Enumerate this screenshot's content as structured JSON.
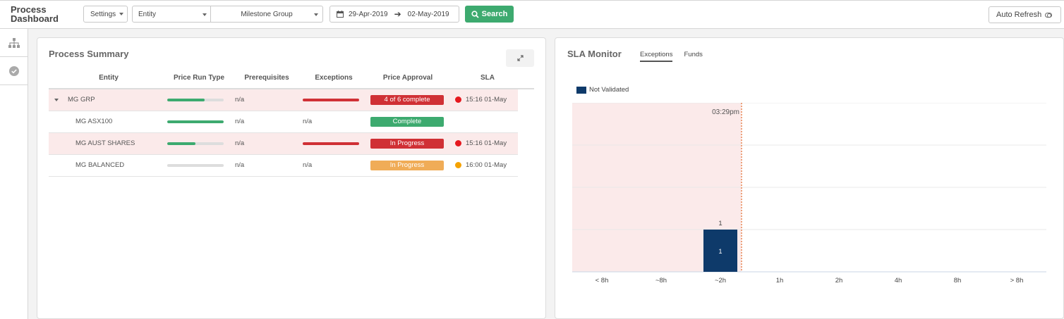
{
  "app": {
    "title_line1": "Process",
    "title_line2": "Dashboard"
  },
  "toolbar": {
    "settings_label": "Settings",
    "entity_value": "Entity",
    "milestone_value": "Milestone Group",
    "date_from": "29-Apr-2019",
    "date_to": "02-May-2019",
    "search_label": "Search",
    "auto_refresh_label": "Auto Refresh"
  },
  "sidebar": {
    "items": [
      {
        "icon": "hierarchy-icon"
      },
      {
        "icon": "check-circle-icon"
      }
    ]
  },
  "process_summary": {
    "title": "Process Summary",
    "columns": [
      "Entity",
      "Price Run Type",
      "Prerequisites",
      "Exceptions",
      "Price Approval",
      "SLA"
    ],
    "rows": [
      {
        "entity": "MG GRP",
        "expandable": true,
        "price_run_progress": 0.66,
        "prerequisites": "n/a",
        "exceptions": "",
        "has_exception_bar": true,
        "approval": "4 of 6 complete",
        "approval_color": "#d03035",
        "sla_dot": "#e5181e",
        "sla": "15:16 01-May",
        "alert": true
      },
      {
        "entity": "MG ASX100",
        "expandable": false,
        "price_run_progress": 1.0,
        "prerequisites": "n/a",
        "exceptions": "n/a",
        "has_exception_bar": false,
        "approval": "Complete",
        "approval_color": "#3daa6f",
        "sla_dot": "",
        "sla": "",
        "alert": false
      },
      {
        "entity": "MG AUST SHARES",
        "expandable": false,
        "price_run_progress": 0.5,
        "prerequisites": "n/a",
        "exceptions": "",
        "has_exception_bar": true,
        "approval": "In Progress",
        "approval_color": "#d03035",
        "sla_dot": "#e5181e",
        "sla": "15:16 01-May",
        "alert": true
      },
      {
        "entity": "MG BALANCED",
        "expandable": false,
        "price_run_progress": 0.0,
        "prerequisites": "n/a",
        "exceptions": "n/a",
        "has_exception_bar": false,
        "approval": "In Progress",
        "approval_color": "#f0ac57",
        "sla_dot": "#f5a200",
        "sla": "16:00 01-May",
        "alert": false
      }
    ]
  },
  "sla_monitor": {
    "title": "SLA Monitor",
    "tabs": [
      {
        "label": "Exceptions",
        "active": true
      },
      {
        "label": "Funds",
        "active": false
      }
    ],
    "now_label": "03:29pm"
  },
  "chart_data": {
    "type": "bar",
    "categories": [
      "< 8h",
      "~8h",
      "~2h",
      "1h",
      "2h",
      "4h",
      "8h",
      "> 8h"
    ],
    "series": [
      {
        "name": "Not Validated",
        "color": "#0e3a6a",
        "values": [
          0,
          0,
          1,
          0,
          0,
          0,
          0,
          0
        ]
      }
    ],
    "data_labels": [
      "",
      "",
      "1",
      "",
      "",
      "",
      "",
      ""
    ],
    "ylim": [
      0,
      4
    ],
    "now_marker": "03:29pm",
    "overdue_region_color": "#fbeaea",
    "grid": true,
    "legend": "top-left"
  }
}
